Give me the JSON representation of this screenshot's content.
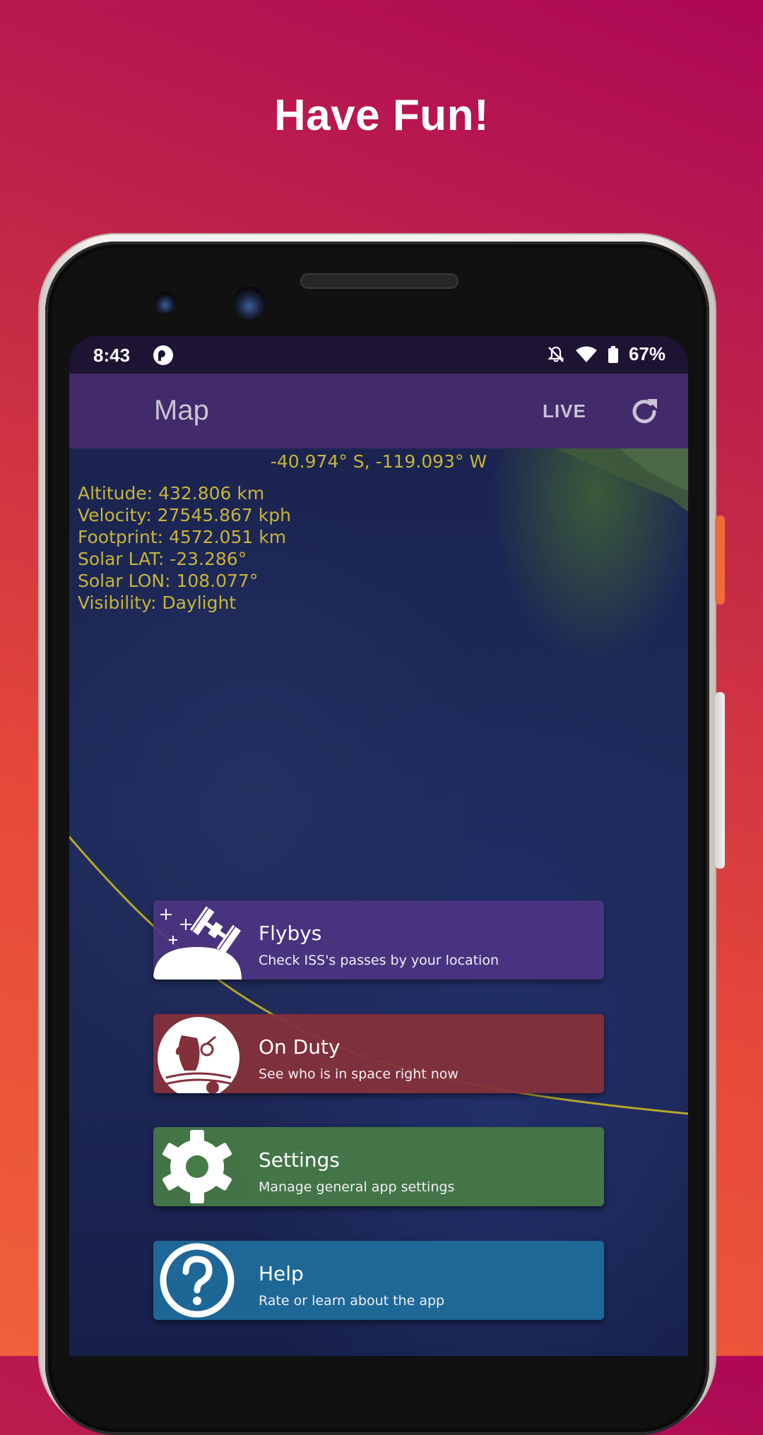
{
  "promo": {
    "headline": "Have Fun!"
  },
  "status_bar": {
    "time": "8:43",
    "battery": "67%"
  },
  "app_bar": {
    "title": "Map",
    "live_label": "LIVE"
  },
  "telemetry": {
    "coordinates": "-40.974° S, -119.093° W",
    "altitude": "Altitude: 432.806 km",
    "velocity": "Velocity: 27545.867 kph",
    "footprint": "Footprint: 4572.051 km",
    "solar_lat": "Solar LAT: -23.286°",
    "solar_lon": "Solar LON: 108.077°",
    "visibility": "Visibility: Daylight"
  },
  "menu": [
    {
      "title": "Flybys",
      "subtitle": "Check ISS's passes by your location",
      "icon": "iss-flyby-icon"
    },
    {
      "title": "On Duty",
      "subtitle": "See who is in space right now",
      "icon": "astronaut-icon"
    },
    {
      "title": "Settings",
      "subtitle": "Manage general app settings",
      "icon": "gear-icon"
    },
    {
      "title": "Help",
      "subtitle": "Rate or learn about the app",
      "icon": "question-icon"
    }
  ],
  "colors": {
    "app_bar": "#432a6b",
    "telemetry_text": "#c7b43a",
    "flybys": "#4c3482",
    "on_duty": "#84303a",
    "settings": "#467c46",
    "help": "#1e6e9c"
  }
}
